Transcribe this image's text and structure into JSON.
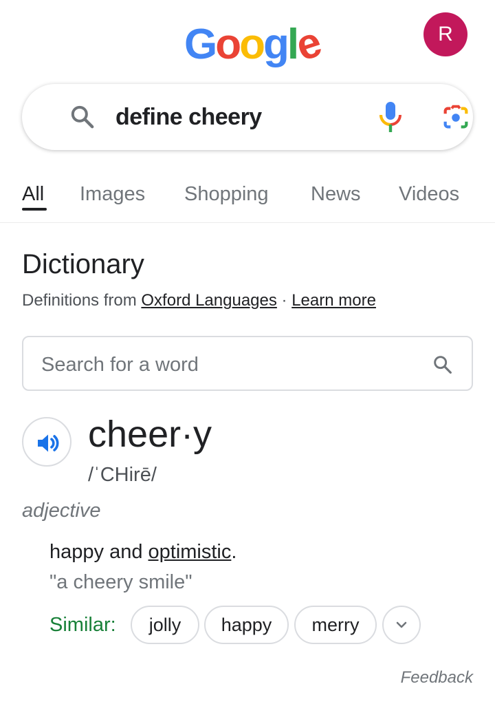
{
  "header": {
    "logo_letters": [
      {
        "char": "G",
        "color": "#4285F4"
      },
      {
        "char": "o",
        "color": "#EA4335"
      },
      {
        "char": "o",
        "color": "#FBBC05"
      },
      {
        "char": "g",
        "color": "#4285F4"
      },
      {
        "char": "l",
        "color": "#34A853"
      },
      {
        "char": "e",
        "color": "#EA4335"
      }
    ],
    "avatar_initial": "R",
    "avatar_color": "#C2185B"
  },
  "search": {
    "query": "define cheery",
    "icons": [
      "search-icon",
      "mic-icon",
      "lens-icon"
    ]
  },
  "tabs": [
    {
      "label": "All",
      "active": true
    },
    {
      "label": "Images",
      "active": false
    },
    {
      "label": "Shopping",
      "active": false
    },
    {
      "label": "News",
      "active": false
    },
    {
      "label": "Videos",
      "active": false
    }
  ],
  "dictionary": {
    "title": "Dictionary",
    "source_prefix": "Definitions from ",
    "source_link": "Oxford Languages",
    "separator": " · ",
    "learn_more": "Learn more",
    "search_placeholder": "Search for a word",
    "headword": "cheer·y",
    "pronunciation": "/ˈCHirē/",
    "part_of_speech": "adjective",
    "definition_prefix": "happy and ",
    "definition_link": "optimistic",
    "definition_suffix": ".",
    "example": "\"a cheery smile\"",
    "similar_label": "Similar:",
    "similar_words": [
      "jolly",
      "happy",
      "merry"
    ],
    "feedback": "Feedback"
  }
}
